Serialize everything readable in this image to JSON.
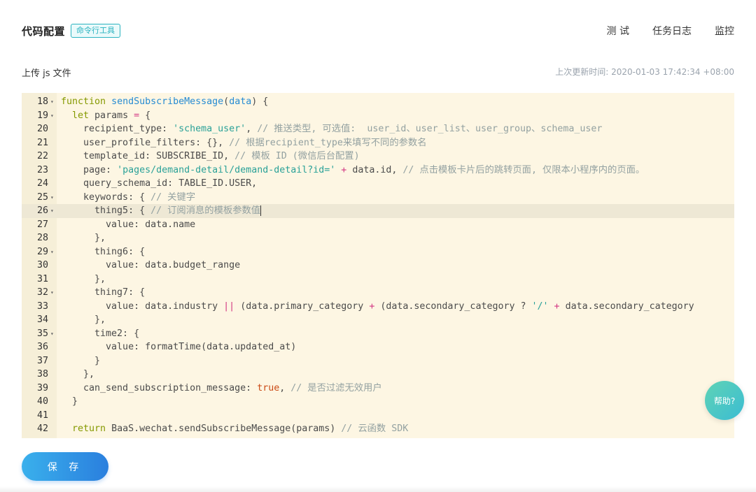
{
  "header": {
    "title": "代码配置",
    "tag": "命令行工具",
    "nav": [
      "测 试",
      "任务日志",
      "监控"
    ]
  },
  "subheader": {
    "upload_label": "上传 js 文件",
    "updated_label": "上次更新时间: 2020-01-03 17:42:34 +08:00"
  },
  "editor": {
    "active_line": 26,
    "lines": [
      {
        "n": "18",
        "fold": true,
        "html": "<span class='kw'>function</span> <span class='fn'>sendSubscribeMessage</span>(<span class='fn'>data</span>) {"
      },
      {
        "n": "19",
        "fold": true,
        "html": "  <span class='kw'>let</span> params <span class='op'>=</span> {"
      },
      {
        "n": "20",
        "fold": false,
        "html": "    recipient_type: <span class='str'>'schema_user'</span>, <span class='cm'>// 推送类型, 可选值:  user_id、user_list、user_group、schema_user</span>"
      },
      {
        "n": "21",
        "fold": false,
        "html": "    user_profile_filters: {}, <span class='cm'>// 根据recipient_type来填写不同的参数名</span>"
      },
      {
        "n": "22",
        "fold": false,
        "html": "    template_id: SUBSCRIBE_ID, <span class='cm'>// 模板 ID (微信后台配置)</span>"
      },
      {
        "n": "23",
        "fold": false,
        "html": "    page: <span class='str'>'pages/demand-detail/demand-detail?id='</span> <span class='op'>+</span> data.id, <span class='cm'>// 点击模板卡片后的跳转页面, 仅限本小程序内的页面。</span>"
      },
      {
        "n": "24",
        "fold": false,
        "html": "    query_schema_id: TABLE_ID.USER,"
      },
      {
        "n": "25",
        "fold": true,
        "html": "    keywords: { <span class='cm'>// 关键字</span>"
      },
      {
        "n": "26",
        "fold": true,
        "html": "      thing5: { <span class='cm'>// 订阅消息的模板参数值</span><span class='cursor'></span>"
      },
      {
        "n": "27",
        "fold": false,
        "html": "        value: data.name"
      },
      {
        "n": "28",
        "fold": false,
        "html": "      },"
      },
      {
        "n": "29",
        "fold": true,
        "html": "      thing6: {"
      },
      {
        "n": "30",
        "fold": false,
        "html": "        value: data.budget_range"
      },
      {
        "n": "31",
        "fold": false,
        "html": "      },"
      },
      {
        "n": "32",
        "fold": true,
        "html": "      thing7: {"
      },
      {
        "n": "33",
        "fold": false,
        "html": "        value: data.industry <span class='op'>||</span> (data.primary_category <span class='op'>+</span> (data.secondary_category ? <span class='str'>'/'</span> <span class='op'>+</span> data.secondary_category"
      },
      {
        "n": "34",
        "fold": false,
        "html": "      },"
      },
      {
        "n": "35",
        "fold": true,
        "html": "      time2: {"
      },
      {
        "n": "36",
        "fold": false,
        "html": "        value: formatTime(data.updated_at)"
      },
      {
        "n": "37",
        "fold": false,
        "html": "      }"
      },
      {
        "n": "38",
        "fold": false,
        "html": "    },"
      },
      {
        "n": "39",
        "fold": false,
        "html": "    can_send_subscription_message: <span class='bool'>true</span>, <span class='cm'>// 是否过滤无效用户</span>"
      },
      {
        "n": "40",
        "fold": false,
        "html": "  }"
      },
      {
        "n": "41",
        "fold": false,
        "html": ""
      },
      {
        "n": "42",
        "fold": false,
        "html": "  <span class='kw'>return</span> BaaS.wechat.sendSubscribeMessage(params) <span class='cm'>// 云函数 SDK</span>"
      }
    ]
  },
  "buttons": {
    "save": "保 存",
    "help": "帮助?"
  }
}
